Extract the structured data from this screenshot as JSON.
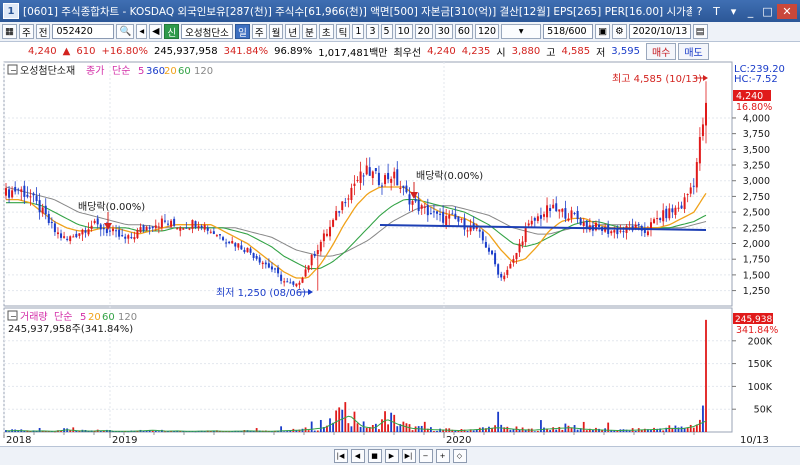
{
  "window": {
    "number": "1",
    "title": "[0601] 주식종합차트 - KOSDAQ 외국인보유[287(천)] 주식수[61,966(천)] 액면[500] 자본금[310(억)] 결산[12월] EPS[265] PER[16.00] 시가총액[2"
  },
  "toolbar": {
    "stock_code": "052420",
    "stock_name": "오성첨단소",
    "period_tabs": [
      "일",
      "주",
      "월",
      "년",
      "분",
      "초",
      "틱"
    ],
    "active_period": "일",
    "interval_buttons": [
      "1",
      "3",
      "5",
      "10",
      "20",
      "30",
      "60",
      "120"
    ],
    "count": "518/600",
    "date": "2020/10/13",
    "misc_labels": [
      "주",
      "전",
      "신"
    ]
  },
  "quote": {
    "price": "4,240",
    "change": "610",
    "change_pct": "+16.80%",
    "volume": "245,937,958",
    "volume_ratio": "341.84%",
    "strength": "96.89%",
    "amount": "1,017,481백만",
    "order_label": "최우선",
    "best_ask": "4,240",
    "best_bid": "4,235",
    "open_label": "시",
    "open": "3,880",
    "high_label": "고",
    "high": "4,585",
    "low_label": "저",
    "low": "3,595",
    "buy_label": "매수",
    "sell_label": "매도"
  },
  "colors": {
    "candle_up": "#e01a1a",
    "candle_down": "#1a3cc9",
    "ma5": "#d32fa8",
    "ma20": "#f0a21a",
    "ma60": "#33a346",
    "ma120": "#888888",
    "trendline": "#1d3fb4"
  },
  "price_panel": {
    "legend": [
      "오성첨단소재",
      "종가",
      "단순",
      "5",
      "360",
      "20",
      "60",
      "120"
    ],
    "lc": "LC:239.20",
    "hc": "HC:-7.52",
    "current_price": "4,240",
    "current_pct": "16.80%"
  },
  "volume_panel": {
    "legend": [
      "거래량",
      "단순",
      "5",
      "20",
      "60",
      "120"
    ],
    "info": "245,937,958주(341.84%)",
    "current": "245,938K",
    "current_pct": "341.84%"
  },
  "annotations": {
    "high": "최고 4,585 (10/13)",
    "low": "최저 1,250 (08/06)",
    "dividend1": "배당락(0.00%)",
    "dividend2": "배당락(0.00%)"
  },
  "x_axis": {
    "labels": [
      "2018",
      "2019",
      "2020"
    ],
    "end_date": "10/13"
  },
  "chart_data": {
    "type": "candlestick",
    "price": {
      "yticks": [
        1250,
        1500,
        1750,
        2000,
        2250,
        2500,
        2750,
        3000,
        3250,
        3500,
        3750,
        4000
      ],
      "ymin": 1100,
      "ymax": 4700,
      "close_path": [
        2800,
        2870,
        2750,
        2500,
        2200,
        2050,
        2180,
        2300,
        2250,
        2150,
        2050,
        2200,
        2300,
        2350,
        2280,
        2300,
        2350,
        2200,
        2100,
        2000,
        1900,
        1750,
        1600,
        1400,
        1300,
        1650,
        2000,
        2300,
        2700,
        3000,
        3150,
        3000,
        3100,
        2800,
        2600,
        2500,
        2400,
        2400,
        2300,
        2200,
        1900,
        1450,
        1700,
        2200,
        2400,
        2550,
        2500,
        2450,
        2300,
        2250,
        2200,
        2200,
        2250,
        2200,
        2400,
        2500,
        2600,
        3000,
        4240
      ],
      "ma20_path": [
        2700,
        2700,
        2650,
        2500,
        2350,
        2250,
        2200,
        2200,
        2250,
        2250,
        2200,
        2150,
        2200,
        2250,
        2300,
        2300,
        2300,
        2300,
        2200,
        2100,
        2000,
        1850,
        1700,
        1550,
        1450,
        1450,
        1650,
        1950,
        2300,
        2600,
        2800,
        2900,
        2900,
        2900,
        2750,
        2600,
        2500,
        2450,
        2400,
        2300,
        2150,
        1900,
        1700,
        1750,
        1950,
        2200,
        2350,
        2400,
        2400,
        2300,
        2250,
        2250,
        2250,
        2250,
        2250,
        2300,
        2400,
        2500,
        2800
      ],
      "ma60_path": [
        2650,
        2650,
        2650,
        2600,
        2500,
        2400,
        2300,
        2250,
        2250,
        2250,
        2250,
        2200,
        2200,
        2200,
        2250,
        2250,
        2250,
        2250,
        2250,
        2200,
        2150,
        2050,
        1950,
        1800,
        1700,
        1600,
        1600,
        1700,
        1850,
        2050,
        2250,
        2450,
        2600,
        2700,
        2700,
        2650,
        2600,
        2550,
        2500,
        2400,
        2300,
        2150,
        2000,
        1950,
        2000,
        2100,
        2200,
        2300,
        2350,
        2350,
        2300,
        2250,
        2250,
        2250,
        2250,
        2250,
        2300,
        2350,
        2450
      ],
      "ma120_path": [
        2900,
        2850,
        2800,
        2750,
        2700,
        2600,
        2500,
        2450,
        2400,
        2350,
        2300,
        2300,
        2280,
        2250,
        2250,
        2250,
        2250,
        2250,
        2250,
        2250,
        2200,
        2150,
        2100,
        2000,
        1900,
        1850,
        1800,
        1800,
        1850,
        1950,
        2050,
        2200,
        2350,
        2450,
        2550,
        2600,
        2600,
        2600,
        2550,
        2500,
        2450,
        2350,
        2250,
        2200,
        2150,
        2150,
        2200,
        2250,
        2250,
        2300,
        2300,
        2300,
        2300,
        2250,
        2250,
        2250,
        2250,
        2300,
        2350
      ]
    },
    "volume": {
      "yticks": [
        50000,
        100000,
        150000,
        200000
      ],
      "ymax": 250000,
      "bars_k": [
        3000,
        4000,
        2500,
        3000,
        2000,
        6000,
        3000,
        2500,
        4000,
        2000,
        2000,
        3000,
        5000,
        2500,
        3000,
        2000,
        2500,
        3000,
        2000,
        2500,
        3000,
        2000,
        2500,
        4000,
        5000,
        8000,
        12000,
        30000,
        45000,
        15000,
        10000,
        35000,
        20000,
        10000,
        8000,
        6000,
        5000,
        4000,
        6000,
        8000,
        12000,
        9000,
        6000,
        5000,
        8000,
        10000,
        12000,
        8000,
        6000,
        5000,
        4000,
        5000,
        6000,
        7000,
        10000,
        9000,
        15000,
        30000,
        245938
      ]
    }
  }
}
